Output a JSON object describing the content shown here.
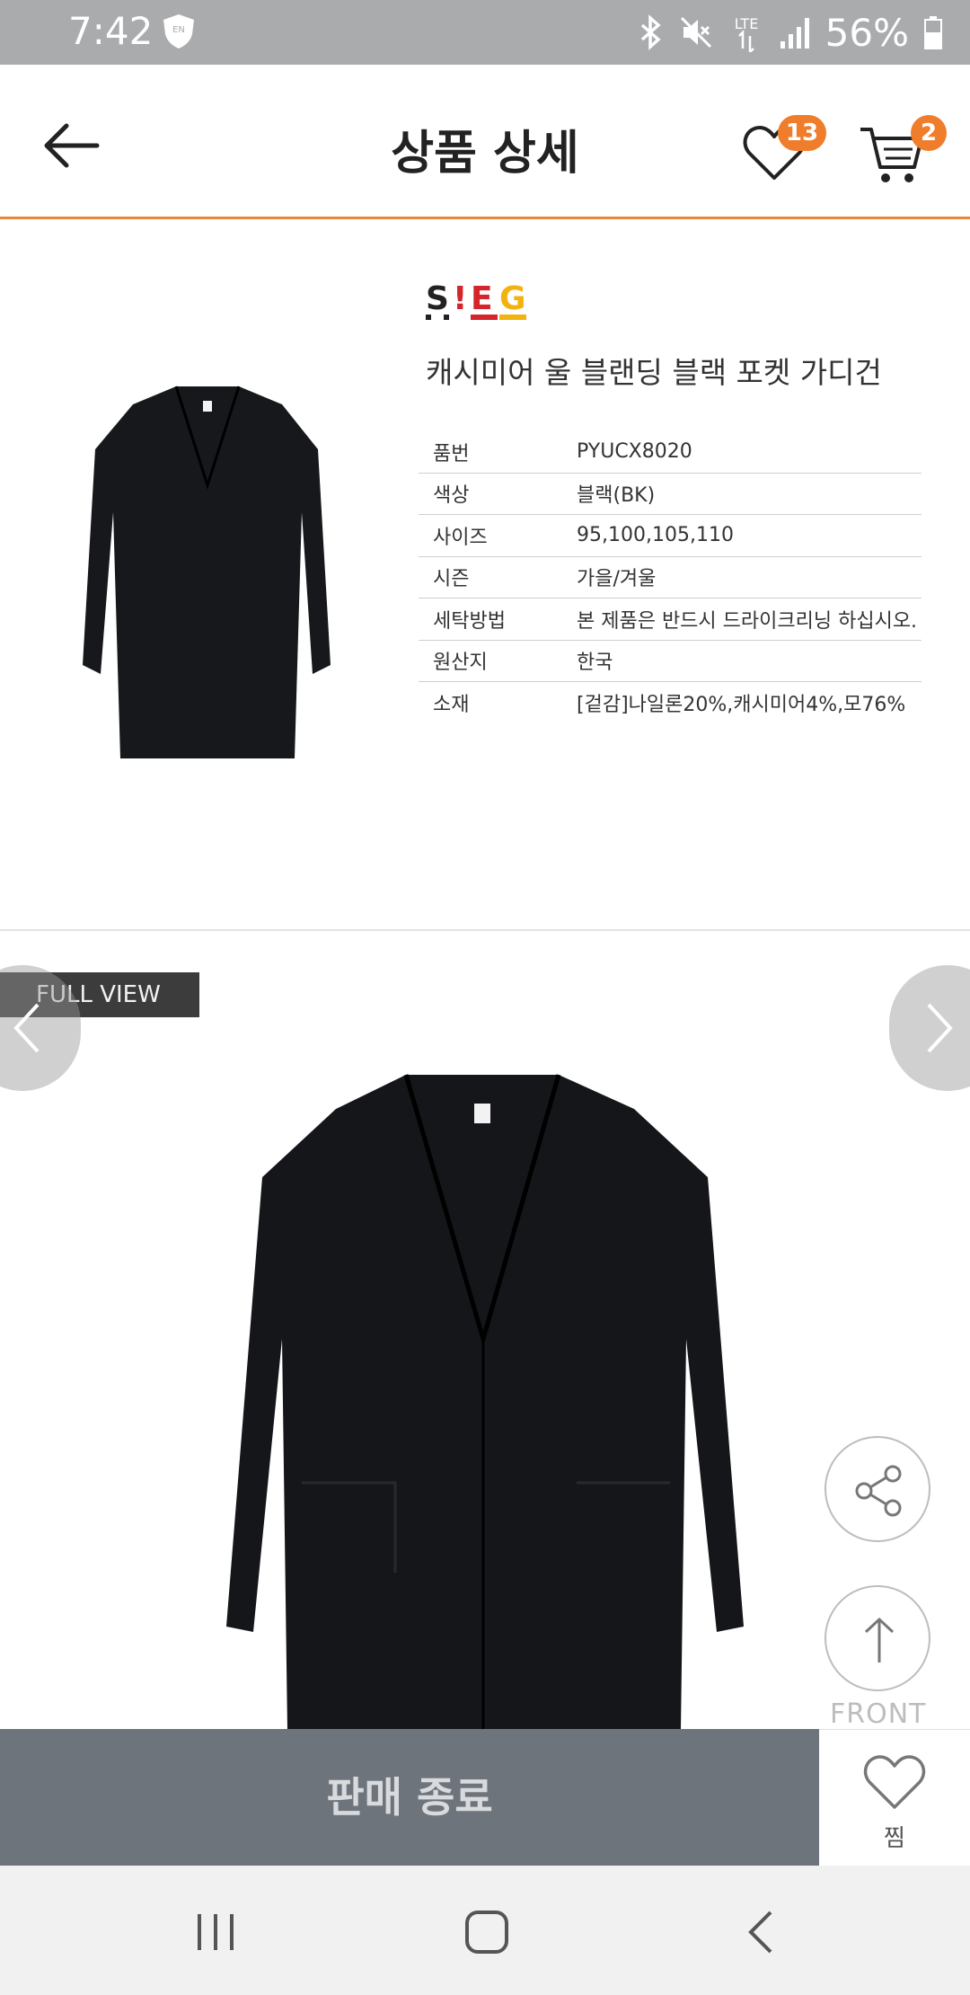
{
  "status_bar": {
    "time": "7:42",
    "battery": "56%",
    "network": "LTE",
    "keyboard_badge": "EN"
  },
  "header": {
    "title": "상품 상세",
    "wishlist_count": "13",
    "cart_count": "2"
  },
  "product": {
    "brand": "SIEG",
    "name": "캐시미어 울 블랜딩 블랙 포켓 가디건",
    "specs": [
      {
        "label": "품번",
        "value": "PYUCX8020"
      },
      {
        "label": "색상",
        "value": "블랙(BK)"
      },
      {
        "label": "사이즈",
        "value": " 95,100,105,110"
      },
      {
        "label": "시즌",
        "value": "가을/겨울"
      },
      {
        "label": "세탁방법",
        "value": "본 제품은 반드시 드라이크리닝 하십시오."
      },
      {
        "label": "원산지",
        "value": "한국"
      },
      {
        "label": "소재",
        "value": "[겉감]나일론20%,캐시미어4%,모76%"
      }
    ]
  },
  "gallery": {
    "full_view_label": "FULL VIEW",
    "front_label": "FRONT"
  },
  "bottom_bar": {
    "sold_out_label": "판매 종료",
    "zzim_label": "찜"
  },
  "colors": {
    "accent": "#f07d2b",
    "header_border": "#e8863a",
    "sold_out_bg": "#6e747c",
    "status_bar_bg": "#a9abad"
  }
}
